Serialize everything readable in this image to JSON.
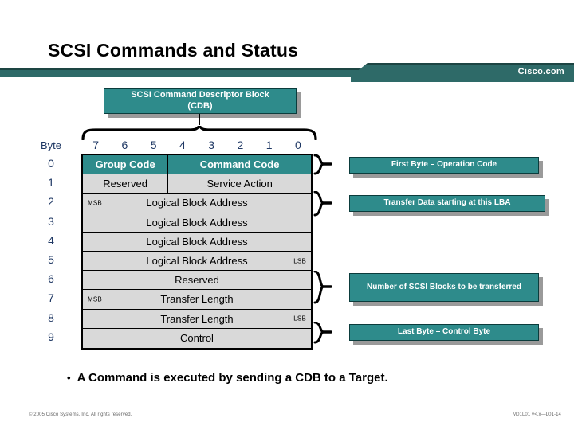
{
  "slide": {
    "title": "SCSI Commands and Status"
  },
  "banner": {
    "label": "Cisco.com",
    "accent_color": "#2e6a68"
  },
  "cdb_title_box": {
    "line1": "SCSI Command Descriptor Block",
    "line2": "(CDB)"
  },
  "table": {
    "byte_header": "Byte",
    "byte_numbers": [
      "0",
      "1",
      "2",
      "3",
      "4",
      "5",
      "6",
      "7",
      "8",
      "9"
    ],
    "bit_numbers": [
      "7",
      "6",
      "5",
      "4",
      "3",
      "2",
      "1",
      "0"
    ],
    "rows": [
      {
        "byte": "0",
        "type": "split",
        "left": "Group Code",
        "right": "Command Code",
        "style": "teal"
      },
      {
        "byte": "1",
        "type": "split",
        "left": "Reserved",
        "right": "Service Action",
        "style": "gray"
      },
      {
        "byte": "2",
        "type": "single",
        "text": "Logical Block Address",
        "msb": "MSB",
        "lsb": "",
        "style": "gray"
      },
      {
        "byte": "3",
        "type": "single",
        "text": "Logical Block Address",
        "msb": "",
        "lsb": "",
        "style": "gray"
      },
      {
        "byte": "4",
        "type": "single",
        "text": "Logical Block Address",
        "msb": "",
        "lsb": "",
        "style": "gray"
      },
      {
        "byte": "5",
        "type": "single",
        "text": "Logical Block Address",
        "msb": "",
        "lsb": "LSB",
        "style": "gray"
      },
      {
        "byte": "6",
        "type": "single",
        "text": "Reserved",
        "msb": "",
        "lsb": "",
        "style": "gray"
      },
      {
        "byte": "7",
        "type": "single",
        "text": "Transfer Length",
        "msb": "MSB",
        "lsb": "",
        "style": "gray"
      },
      {
        "byte": "8",
        "type": "single",
        "text": "Transfer Length",
        "msb": "",
        "lsb": "LSB",
        "style": "gray"
      },
      {
        "byte": "9",
        "type": "single",
        "text": "Control",
        "msb": "",
        "lsb": "",
        "style": "gray"
      }
    ]
  },
  "callouts": {
    "opcode": "First Byte – Operation Code",
    "lba": "Transfer Data starting at this LBA",
    "blocks": "Number of SCSI Blocks to be transferred",
    "control": "Last Byte – Control Byte"
  },
  "bullet": {
    "marker": "•",
    "text": "A Command is executed by sending a CDB to a Target."
  },
  "footer": {
    "left": "© 2005 Cisco Systems, Inc. All rights reserved.",
    "right": "M01L01 v<.x—L01-14"
  },
  "colors": {
    "teal": "#2e8b8b",
    "banner_teal": "#2e6a68",
    "row_gray": "#d9d9d9",
    "label_blue": "#1f3864"
  }
}
